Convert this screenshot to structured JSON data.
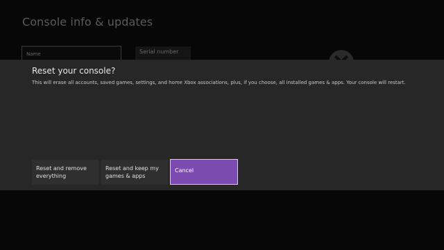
{
  "background": {
    "title": "Console info & updates",
    "name_label": "Name",
    "serial_label": "Serial number"
  },
  "dialog": {
    "title": "Reset your console?",
    "message": "This will erase all accounts, saved games, settings, and home Xbox associations, plus, if you choose, all installed games & apps. Your console will restart.",
    "buttons": {
      "reset_all": "Reset and remove everything",
      "reset_keep": "Reset and keep my games & apps",
      "cancel": "Cancel"
    }
  },
  "colors": {
    "dialog_bg": "#272727",
    "button_bg": "#2f2f2f",
    "focus_accent": "#7b4bb0"
  }
}
